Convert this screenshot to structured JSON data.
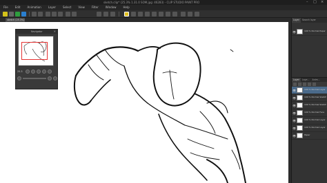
{
  "window": {
    "title": "sketch.clip* (25.3% 1.31.0 SOM.jpg: 46283) - CLIP STUDIO PAINT PRO",
    "minimize": "–",
    "maximize": "□",
    "close": "×"
  },
  "menu": {
    "items": [
      "File",
      "Edit",
      "Animation",
      "Layer",
      "Select",
      "View",
      "Filter",
      "Window",
      "Help"
    ]
  },
  "toolbar": {
    "colors": {
      "accent_yellow": "#d4c21a",
      "accent_green": "#2e9e3e",
      "accent_blue": "#2a7fd0",
      "active_tool": "#e0c020"
    }
  },
  "document": {
    "tab_label": "sketch (25.3%)"
  },
  "navigator": {
    "title": "Navigator",
    "zoom_value": "25.3",
    "close": "×"
  },
  "right_panel": {
    "top_tabs": [
      "Layer",
      "Search layer"
    ],
    "top_layer": {
      "name": "100 % Normal Paper"
    },
    "middle_tabs": [
      "Layer",
      "Laye...",
      "Anim..."
    ],
    "layers": [
      {
        "name": "100 % Normal Layer 1",
        "selected": true
      },
      {
        "name": "100 % Normal Sketch",
        "selected": false
      },
      {
        "name": "100 % Normal Sketch 2",
        "selected": false
      },
      {
        "name": "100 % Normal Face",
        "selected": false
      },
      {
        "name": "100 % Normal Layer 2",
        "selected": false
      },
      {
        "name": "100 % Normal Layer 3",
        "selected": false
      },
      {
        "name": "Paper",
        "selected": false
      }
    ]
  }
}
